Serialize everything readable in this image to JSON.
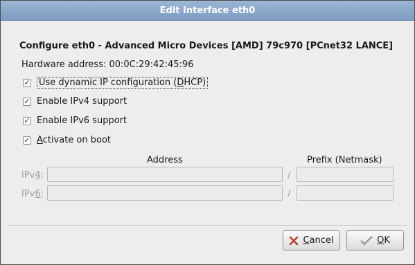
{
  "window": {
    "title": "Edit Interface eth0"
  },
  "heading": "Configure eth0 - Advanced Micro Devices [AMD] 79c970 [PCnet32 LANCE]",
  "hardware_address": "Hardware address: 00:0C:29:42:45:96",
  "options": [
    {
      "label_pre": "Use dynamic IP configuration (",
      "label_mnemonic": "D",
      "label_post": "HCP)",
      "checked": true
    },
    {
      "label_pre": "Enable IPv4 support",
      "label_mnemonic": "",
      "label_post": "",
      "checked": true
    },
    {
      "label_pre": "Enable IPv6 support",
      "label_mnemonic": "",
      "label_post": "",
      "checked": true
    },
    {
      "label_pre": "",
      "label_mnemonic": "A",
      "label_post": "ctivate on boot",
      "checked": true
    }
  ],
  "addresses": {
    "address_header": "Address",
    "prefix_header": "Prefix (Netmask)",
    "ipv4": {
      "label_pre": "IPv",
      "label_mnemonic": "4",
      "label_post": ":",
      "address": "",
      "prefix": ""
    },
    "ipv6": {
      "label_pre": "IPv",
      "label_mnemonic": "6",
      "label_post": ":",
      "address": "",
      "prefix": ""
    },
    "separator": "/"
  },
  "buttons": {
    "cancel": {
      "mnemonic": "C",
      "rest": "ancel",
      "icon": "cancel-x-icon"
    },
    "ok": {
      "mnemonic": "O",
      "rest": "K",
      "icon": "checkmark-icon"
    }
  },
  "colors": {
    "titlebar": "#8aa6c9",
    "cancel_icon": "#c0392b",
    "ok_icon": "#3a3a3a"
  }
}
